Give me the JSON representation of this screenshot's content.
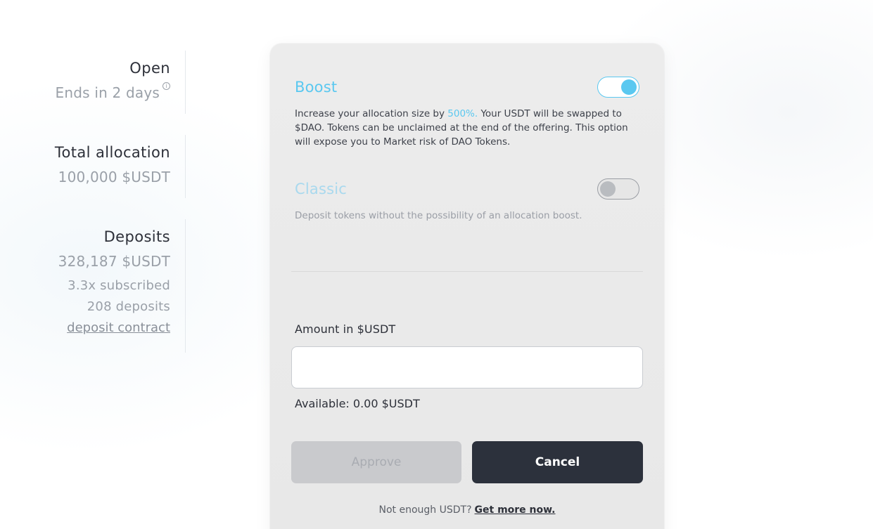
{
  "stats": {
    "status": {
      "title": "Open",
      "value": "Ends in 2 days",
      "info_icon": "i"
    },
    "total_allocation": {
      "title": "Total allocation",
      "value": "100,000 $USDT"
    },
    "deposits": {
      "title": "Deposits",
      "value": "328,187 $USDT",
      "subscribed": "3.3x subscribed",
      "count": "208 deposits",
      "contract_link": "deposit contract"
    }
  },
  "boost": {
    "label": "Boost",
    "enabled": true,
    "desc_prefix": "Increase your allocation size by ",
    "desc_highlight": "500%.",
    "desc_suffix": " Your USDT will be swapped to $DAO. Tokens can be unclaimed at the end of the offering. This option will expose you to Market risk of DAO Tokens."
  },
  "classic": {
    "label": "Classic",
    "enabled": false,
    "desc": "Deposit tokens without the possibility of an allocation boost."
  },
  "amount": {
    "label": "Amount in $USDT",
    "value": "",
    "placeholder": "",
    "available": "Available: 0.00 $USDT"
  },
  "buttons": {
    "approve": "Approve",
    "cancel": "Cancel"
  },
  "footer": {
    "note": "Not enough USDT?",
    "link": "Get more now."
  },
  "colors": {
    "accent": "#5ac8f0",
    "dark_button": "#2c313c",
    "disabled_button": "#c9cacd"
  }
}
